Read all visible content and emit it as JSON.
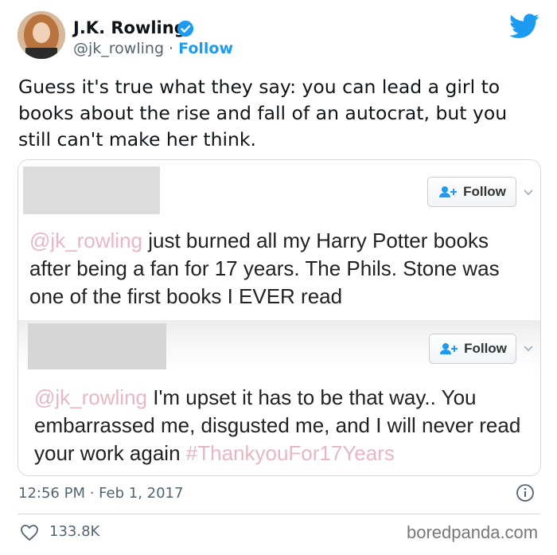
{
  "author": {
    "name": "J.K. Rowling",
    "handle": "@jk_rowling",
    "separator": " · ",
    "follow_label": "Follow"
  },
  "tweet": {
    "text": "Guess it's true what they say: you can lead a girl to books about the rise and fall of an autocrat, but you still can't make her think."
  },
  "embedded": [
    {
      "follow_label": "Follow",
      "mention": "@jk_rowling",
      "text": " just burned all my Harry Potter books after being a fan for 17 years. The Phils. Stone was one of the first books I EVER read"
    },
    {
      "follow_label": "Follow",
      "mention": "@jk_rowling",
      "text": " I'm upset it has to be that way.. You embarrassed me, disgusted me, and I will never read your work again ",
      "hashtag": "#ThankyouFor17Years"
    }
  ],
  "footer": {
    "timestamp": "12:56 PM · Feb 1, 2017",
    "like_count": "133.8K",
    "watermark": "boredpanda.com"
  },
  "colors": {
    "accent": "#1d9bf0",
    "secondary_text": "#536471",
    "mention": "#e8b7c2"
  },
  "icons": [
    "avatar",
    "verified-icon",
    "twitter-bird-icon",
    "add-user-icon",
    "chevron-down-icon",
    "info-icon",
    "heart-icon"
  ]
}
